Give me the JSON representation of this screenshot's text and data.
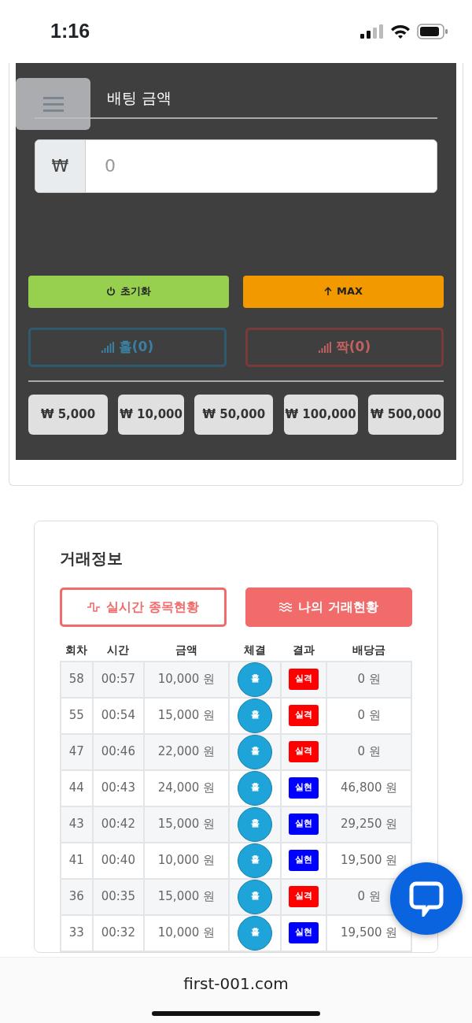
{
  "status_bar": {
    "time": "1:16"
  },
  "bet_panel": {
    "title": "배팅 금액",
    "currency": "₩",
    "amount_placeholder": "0",
    "actions": [
      {
        "kind": "reset",
        "label": "초기화"
      },
      {
        "kind": "max",
        "label": "MAX"
      }
    ],
    "picks": [
      {
        "kind": "odd",
        "label": "홀(0)"
      },
      {
        "kind": "even",
        "label": "짝(0)"
      }
    ],
    "chips": [
      "₩ 5,000",
      "₩ 10,000",
      "₩ 50,000",
      "₩ 100,000",
      "₩ 500,000"
    ]
  },
  "trade_info": {
    "title": "거래정보",
    "tabs": [
      {
        "label": "실시간 종목현황",
        "selected": false
      },
      {
        "label": "나의 거래현황",
        "selected": true
      }
    ],
    "table": {
      "columns": [
        "회차",
        "시간",
        "금액",
        "체결",
        "결과",
        "배당금"
      ],
      "rows": [
        {
          "round": "58",
          "time": "00:57",
          "amount": "10,000 원",
          "pick": "홀",
          "result": "실격",
          "kind": "lose",
          "payout": "0 원"
        },
        {
          "round": "55",
          "time": "00:54",
          "amount": "15,000 원",
          "pick": "홀",
          "result": "실격",
          "kind": "lose",
          "payout": "0 원"
        },
        {
          "round": "47",
          "time": "00:46",
          "amount": "22,000 원",
          "pick": "홀",
          "result": "실격",
          "kind": "lose",
          "payout": "0 원"
        },
        {
          "round": "44",
          "time": "00:43",
          "amount": "24,000 원",
          "pick": "홀",
          "result": "실현",
          "kind": "win",
          "payout": "46,800 원"
        },
        {
          "round": "43",
          "time": "00:42",
          "amount": "15,000 원",
          "pick": "홀",
          "result": "실현",
          "kind": "win",
          "payout": "29,250 원"
        },
        {
          "round": "41",
          "time": "00:40",
          "amount": "10,000 원",
          "pick": "홀",
          "result": "실현",
          "kind": "win",
          "payout": "19,500 원"
        },
        {
          "round": "36",
          "time": "00:35",
          "amount": "15,000 원",
          "pick": "홀",
          "result": "실격",
          "kind": "lose",
          "payout": "0 원"
        },
        {
          "round": "33",
          "time": "00:32",
          "amount": "10,000 원",
          "pick": "홀",
          "result": "실현",
          "kind": "win",
          "payout": "19,500 원"
        }
      ]
    }
  },
  "browser_bar": {
    "url": "first-001.com"
  }
}
